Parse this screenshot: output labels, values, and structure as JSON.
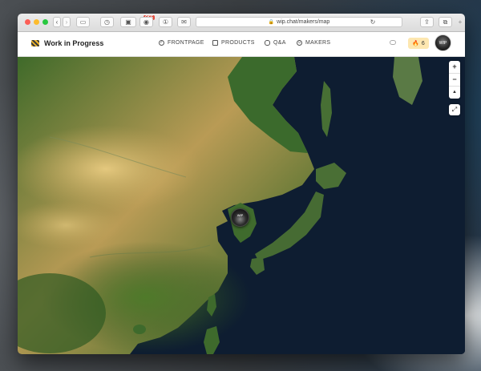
{
  "browser": {
    "url": "wip.chat/makers/map",
    "off_badge": "OFF"
  },
  "site": {
    "brand": "Work in Progress",
    "nav": [
      {
        "label": "FRONTPAGE",
        "icon": "check-circle-icon"
      },
      {
        "label": "PRODUCTS",
        "icon": "cube-icon"
      },
      {
        "label": "Q&A",
        "icon": "chat-bubbles-icon"
      },
      {
        "label": "MAKERS",
        "icon": "smiley-icon"
      }
    ],
    "streak_count": "6",
    "avatar_text": "WIP"
  },
  "map": {
    "zoom_in": "+",
    "zoom_out": "−",
    "compass": "▲",
    "fullscreen": "⤢",
    "marker_text": "WIP"
  }
}
